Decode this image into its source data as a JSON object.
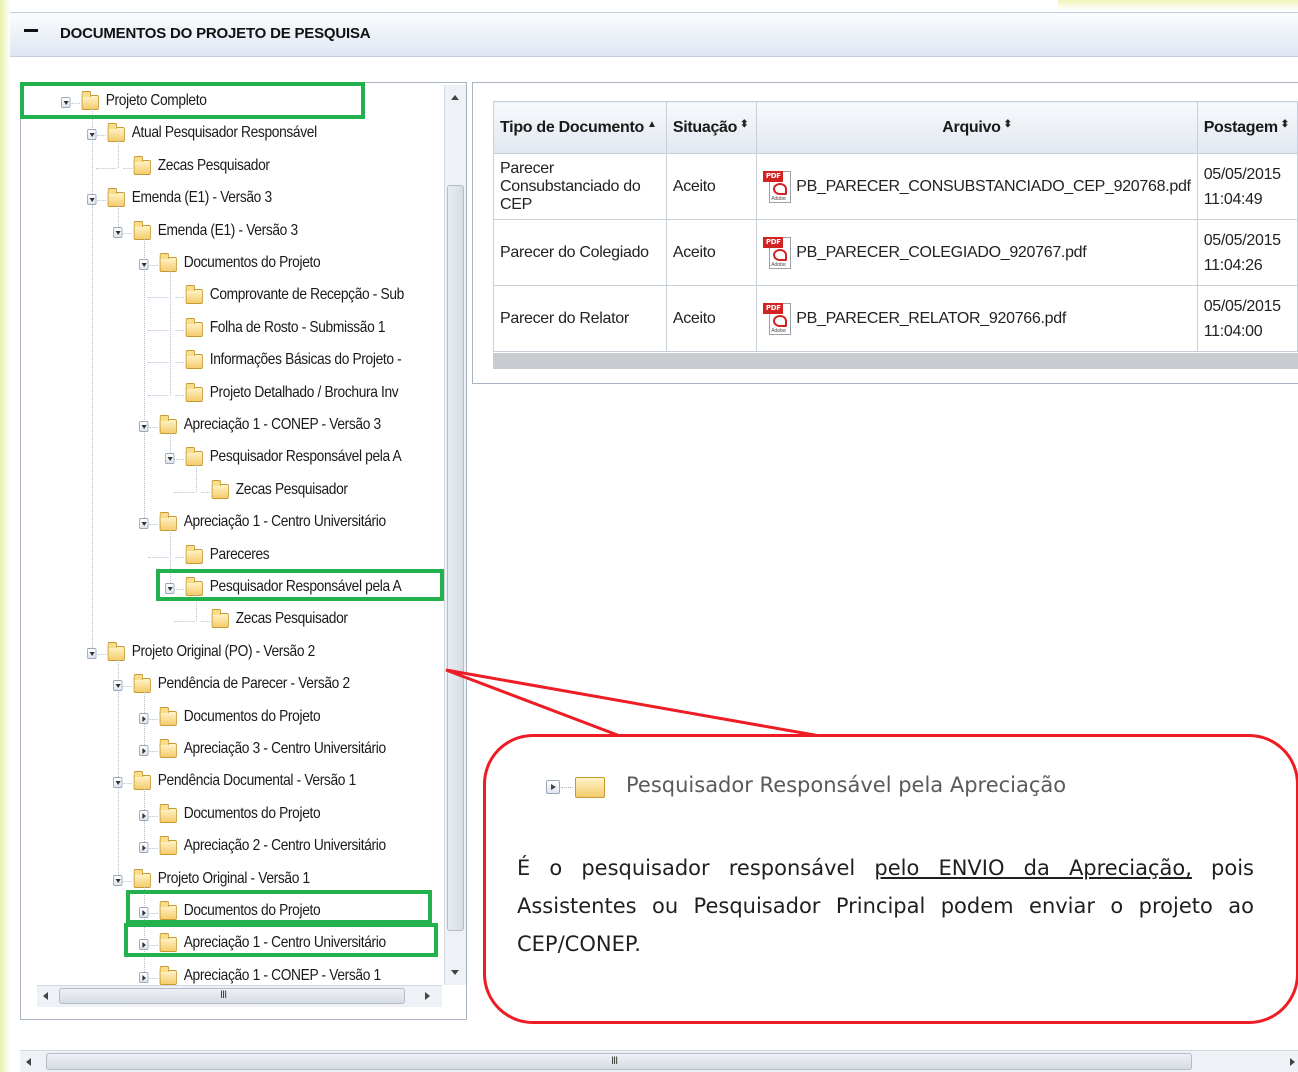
{
  "panel": {
    "title": "DOCUMENTOS DO PROJETO DE PESQUISA"
  },
  "tree": [
    {
      "label": "Projeto Completo",
      "depth": 0,
      "toggle": "open"
    },
    {
      "label": "Atual Pesquisador Responsável",
      "depth": 1,
      "toggle": "open"
    },
    {
      "label": "Zecas Pesquisador",
      "depth": 2,
      "toggle": "none"
    },
    {
      "label": "Emenda (E1) - Versão 3",
      "depth": 1,
      "toggle": "open"
    },
    {
      "label": "Emenda (E1) - Versão 3",
      "depth": 2,
      "toggle": "open"
    },
    {
      "label": "Documentos do Projeto",
      "depth": 3,
      "toggle": "open"
    },
    {
      "label": "Comprovante de Recepção - Sub",
      "depth": 4,
      "toggle": "none"
    },
    {
      "label": "Folha de Rosto - Submissão 1",
      "depth": 4,
      "toggle": "none"
    },
    {
      "label": "Informações Básicas do Projeto -",
      "depth": 4,
      "toggle": "none"
    },
    {
      "label": "Projeto Detalhado / Brochura Inv",
      "depth": 4,
      "toggle": "none"
    },
    {
      "label": "Apreciação 1 - CONEP - Versão 3",
      "depth": 3,
      "toggle": "open"
    },
    {
      "label": "Pesquisador Responsável pela A",
      "depth": 4,
      "toggle": "open"
    },
    {
      "label": "Zecas Pesquisador",
      "depth": 5,
      "toggle": "none"
    },
    {
      "label": "Apreciação 1 - Centro Universitário",
      "depth": 3,
      "toggle": "open"
    },
    {
      "label": "Pareceres",
      "depth": 4,
      "toggle": "none"
    },
    {
      "label": "Pesquisador Responsável pela A",
      "depth": 4,
      "toggle": "open"
    },
    {
      "label": "Zecas Pesquisador",
      "depth": 5,
      "toggle": "none"
    },
    {
      "label": "Projeto Original (PO) - Versão 2",
      "depth": 1,
      "toggle": "open"
    },
    {
      "label": "Pendência de Parecer - Versão 2",
      "depth": 2,
      "toggle": "open"
    },
    {
      "label": "Documentos do Projeto",
      "depth": 3,
      "toggle": "closed"
    },
    {
      "label": "Apreciação 3 - Centro Universitário",
      "depth": 3,
      "toggle": "closed"
    },
    {
      "label": "Pendência Documental - Versão 1",
      "depth": 2,
      "toggle": "open"
    },
    {
      "label": "Documentos do Projeto",
      "depth": 3,
      "toggle": "closed"
    },
    {
      "label": "Apreciação 2 - Centro Universitário",
      "depth": 3,
      "toggle": "closed"
    },
    {
      "label": "Projeto Original - Versão 1",
      "depth": 2,
      "toggle": "open"
    },
    {
      "label": "Documentos do Projeto",
      "depth": 3,
      "toggle": "closed"
    },
    {
      "label": "Apreciação 1 - Centro Universitário",
      "depth": 3,
      "toggle": "closed"
    },
    {
      "label": "Apreciação 1 - CONEP - Versão 1",
      "depth": 3,
      "toggle": "closed"
    }
  ],
  "table": {
    "headers": [
      "Tipo de Documento",
      "Situação",
      "Arquivo",
      "Postagem"
    ],
    "rows": [
      {
        "tipo": "Parecer Consubstanciado do CEP",
        "situacao": "Aceito",
        "arquivo": "PB_PARECER_CONSUBSTANCIADO_CEP_920768.pdf",
        "data": "05/05/2015",
        "hora": "11:04:49"
      },
      {
        "tipo": "Parecer do Colegiado",
        "situacao": "Aceito",
        "arquivo": "PB_PARECER_COLEGIADO_920767.pdf",
        "data": "05/05/2015",
        "hora": "11:04:26"
      },
      {
        "tipo": "Parecer do Relator",
        "situacao": "Aceito",
        "arquivo": "PB_PARECER_RELATOR_920766.pdf",
        "data": "05/05/2015",
        "hora": "11:04:00"
      }
    ],
    "pdf_badge": "PDF",
    "pdf_brand": "Adobe"
  },
  "callout": {
    "tree_label": "Pesquisador Responsável pela Apreciação",
    "text_before": "É o pesquisador responsável ",
    "text_underlined": "pelo ENVIO da Apreciação,",
    "text_after": " pois Assistentes ou Pesquisador Principal podem enviar o projeto ao CEP/CONEP."
  },
  "scroll_grip": "III",
  "colors": {
    "highlight": "#22b14c",
    "callout": "#ee1c24",
    "pdf": "#d32222",
    "header_bg": "#dfe7f3"
  }
}
